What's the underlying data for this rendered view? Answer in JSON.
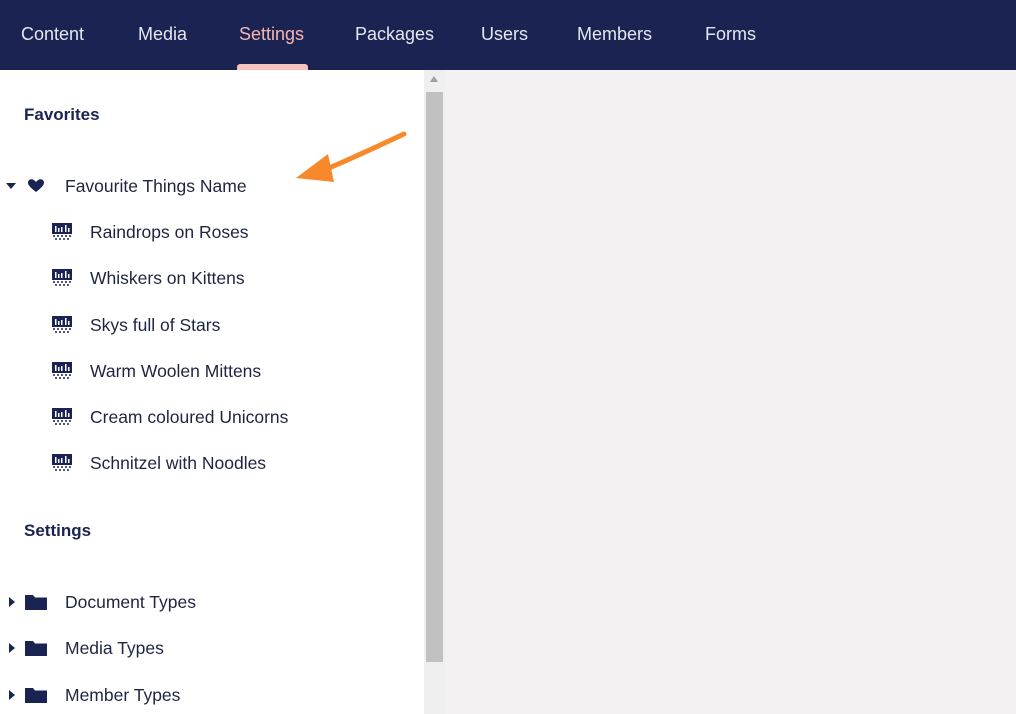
{
  "nav": {
    "items": [
      {
        "label": "Content"
      },
      {
        "label": "Media"
      },
      {
        "label": "Settings",
        "active": true
      },
      {
        "label": "Packages"
      },
      {
        "label": "Users"
      },
      {
        "label": "Members"
      },
      {
        "label": "Forms"
      }
    ]
  },
  "favorites": {
    "title": "Favorites",
    "root": {
      "label": "Favourite Things Name",
      "icon": "heart-icon",
      "expanded": true
    },
    "children": [
      {
        "label": "Raindrops on Roses",
        "icon": "barcode-icon"
      },
      {
        "label": "Whiskers on Kittens",
        "icon": "barcode-icon"
      },
      {
        "label": "Skys full of Stars",
        "icon": "barcode-icon"
      },
      {
        "label": "Warm Woolen Mittens",
        "icon": "barcode-icon"
      },
      {
        "label": "Cream coloured Unicorns",
        "icon": "barcode-icon"
      },
      {
        "label": "Schnitzel with Noodles",
        "icon": "barcode-icon"
      }
    ]
  },
  "settings": {
    "title": "Settings",
    "items": [
      {
        "label": "Document Types",
        "icon": "folder-icon",
        "expanded": false
      },
      {
        "label": "Media Types",
        "icon": "folder-icon",
        "expanded": false
      },
      {
        "label": "Member Types",
        "icon": "folder-icon",
        "expanded": false
      }
    ]
  },
  "colors": {
    "topbar": "#1b2353",
    "active_nav": "#f5b6b0",
    "icon": "#1b2353",
    "annotation_arrow": "#f7892a"
  }
}
